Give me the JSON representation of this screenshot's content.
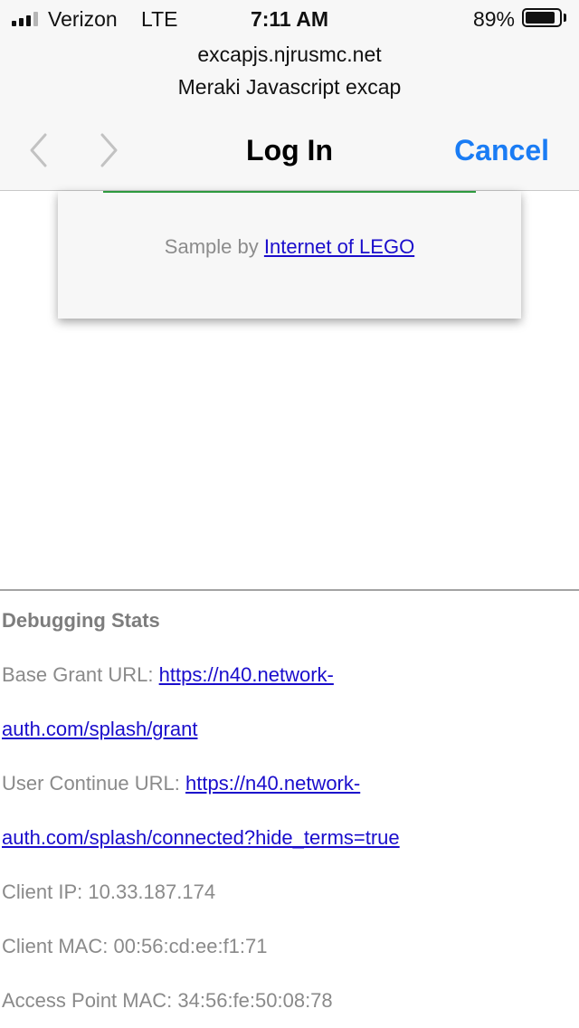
{
  "status_bar": {
    "carrier": "Verizon",
    "network": "LTE",
    "time": "7:11 AM",
    "battery_percent": "89%",
    "battery_level": 0.89,
    "signal_bars_filled": 3,
    "signal_bars_total": 4
  },
  "header": {
    "host": "excapjs.njrusmc.net",
    "page_title": "Meraki Javascript excap"
  },
  "nav": {
    "back_icon": "chevron-left-icon",
    "forward_icon": "chevron-right-icon",
    "title": "Log In",
    "cancel_label": "Cancel"
  },
  "card": {
    "credit_prefix": "Sample by",
    "credit_link": "Internet of LEGO"
  },
  "debug": {
    "heading": "Debugging Stats",
    "base_grant_label": "Base Grant URL:",
    "base_grant_link_1": "https://n40.network-",
    "base_grant_link_2": "auth.com/splash/grant",
    "user_continue_label": "User Continue URL:",
    "user_continue_link_1": "https://n40.network-",
    "user_continue_link_2": "auth.com/splash/connected?hide_terms=true",
    "client_ip": "Client IP: 10.33.187.174",
    "client_mac": "Client MAC: 00:56:cd:ee:f1:71",
    "access_point_mac": "Access Point MAC: 34:56:fe:50:08:78"
  },
  "colors": {
    "link_blue": "#1a0dcc",
    "ios_blue": "#1a7cf4",
    "accent_green": "#2e9a3e",
    "muted_text": "#8a8a8a"
  }
}
